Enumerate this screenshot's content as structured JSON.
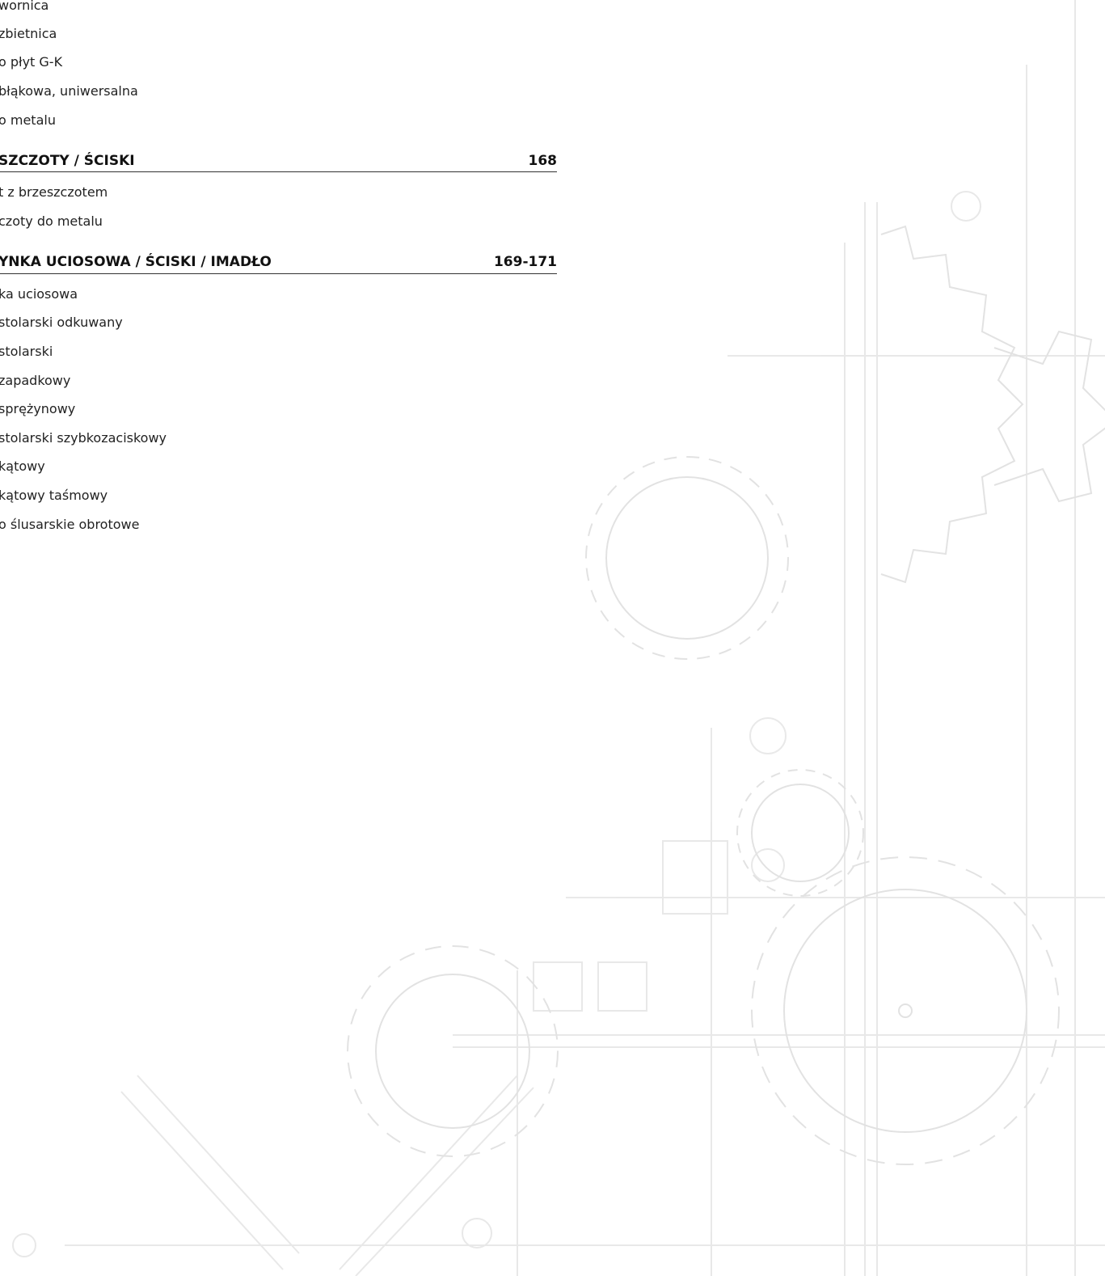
{
  "sections": [
    {
      "title": "",
      "page": "",
      "items": [
        "wornica",
        "zbietnica",
        "o płyt G-K",
        "błąkowa, uniwersalna",
        "o metalu"
      ]
    },
    {
      "title": "SZCZOTY / ŚCISKI",
      "page": "168",
      "items": [
        "t z brzeszczotem",
        "czoty do metalu"
      ]
    },
    {
      "title": "YNKA UCIOSOWA / ŚCISKI / IMADŁO",
      "page": "169-171",
      "items": [
        "ka uciosowa",
        "stolarski odkuwany",
        "stolarski",
        "zapadkowy",
        "sprężynowy",
        "stolarski szybkozaciskowy",
        "kątowy",
        "kątowy taśmowy",
        "o ślusarskie obrotowe"
      ]
    }
  ],
  "colors": {
    "text": "#222222",
    "heading": "#111111",
    "rule": "#333333",
    "background_art": "#cfcfcf"
  }
}
